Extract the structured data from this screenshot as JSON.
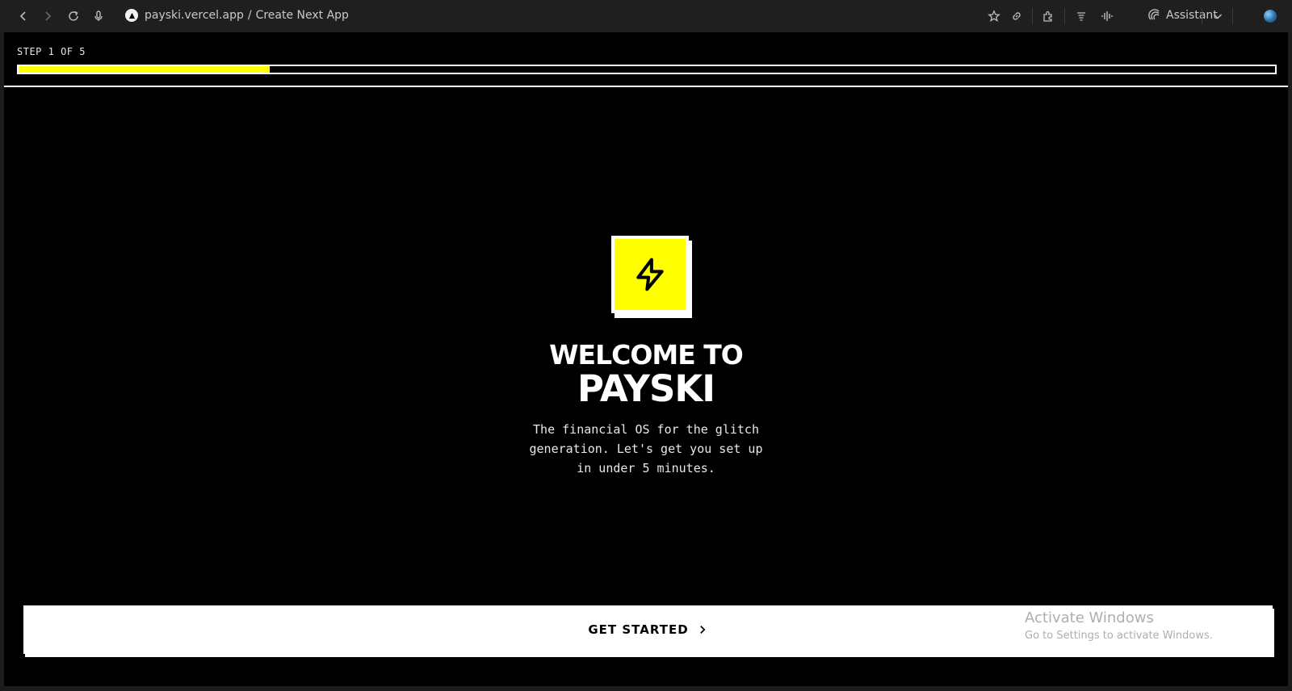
{
  "browser": {
    "url_host": "payski.vercel.app",
    "url_separator": "/",
    "page_title": "Create Next App",
    "assistant_label": "Assistant",
    "icons": {
      "back": "back-arrow-icon",
      "forward": "forward-arrow-icon",
      "reload": "reload-icon",
      "mic": "microphone-icon",
      "bookmark": "star-icon",
      "link": "link-icon",
      "extensions": "puzzle-icon",
      "reader": "reader-icon",
      "voice": "voice-wave-icon",
      "assistant": "assistant-icon",
      "menu": "chevron-down-icon",
      "profile": "globe-icon"
    }
  },
  "onboarding": {
    "step_label": "STEP 1 OF 5",
    "progress_fraction": 0.2,
    "welcome_line": "WELCOME TO",
    "brand_name": "PAYSKI",
    "tagline_lines": [
      "The financial OS for the glitch",
      "generation. Let's get you set up",
      "in under 5 minutes."
    ],
    "cta_label": "GET STARTED",
    "logo_icon": "lightning-bolt-icon"
  },
  "os_watermark": {
    "title": "Activate Windows",
    "subtitle": "Go to Settings to activate Windows."
  },
  "colors": {
    "accent": "#ffff00",
    "background": "#000000",
    "foreground": "#ffffff",
    "browser_chrome": "#1f1f1f"
  }
}
